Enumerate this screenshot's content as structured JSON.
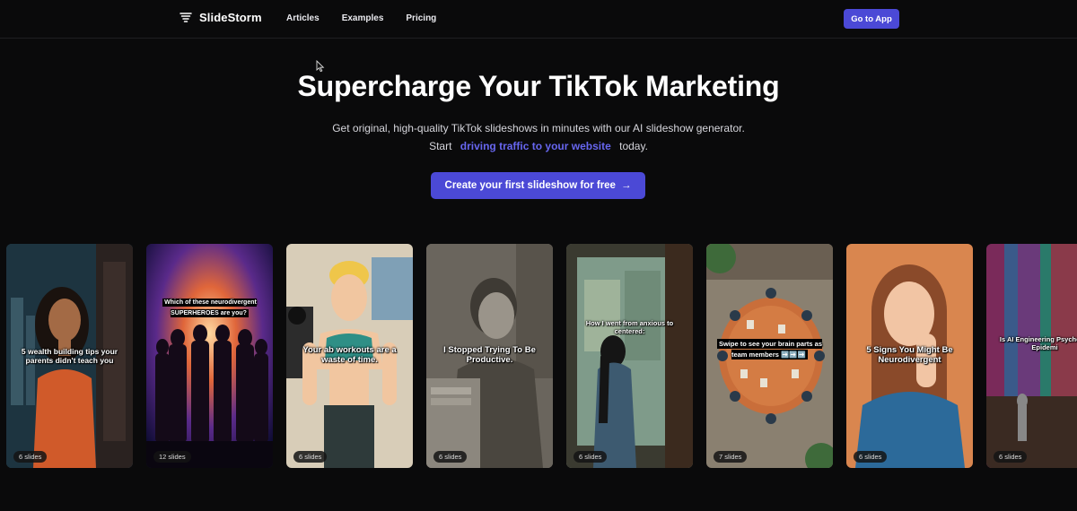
{
  "nav": {
    "brand": "SlideStorm",
    "links": [
      "Articles",
      "Examples",
      "Pricing"
    ],
    "cta": "Go to App"
  },
  "hero": {
    "title": "Supercharge Your TikTok Marketing",
    "subtitle": "Get original, high-quality TikTok slideshows in minutes with our AI slideshow generator.",
    "line2_start": "Start",
    "line2_highlight": "driving traffic to your website",
    "line2_end": "today.",
    "cta": "Create your first slideshow for free"
  },
  "colors": {
    "accent": "#4b49d6",
    "highlight": "#6766ef",
    "background": "#0a0a0b"
  },
  "cards": [
    {
      "caption": "5 wealth building tips your parents didn't teach you",
      "badge": "6 slides"
    },
    {
      "caption": "Which of these neurodivergent SUPERHEROES are you?",
      "badge": "12 slides"
    },
    {
      "caption": "Your ab workouts are a waste of time.",
      "badge": "6 slides"
    },
    {
      "caption": "I Stopped Trying To Be Productive.",
      "badge": "6 slides"
    },
    {
      "caption": "How I went from anxious to centered:",
      "badge": "6 slides"
    },
    {
      "caption": "Swipe to see your brain parts as team members ➡️➡️➡️",
      "badge": "7 slides"
    },
    {
      "caption": "5 Signs You Might Be Neurodivergent",
      "badge": "6 slides"
    },
    {
      "caption": "Is AI Engineering Psychosis Epidemi",
      "badge": "6 slides"
    }
  ]
}
